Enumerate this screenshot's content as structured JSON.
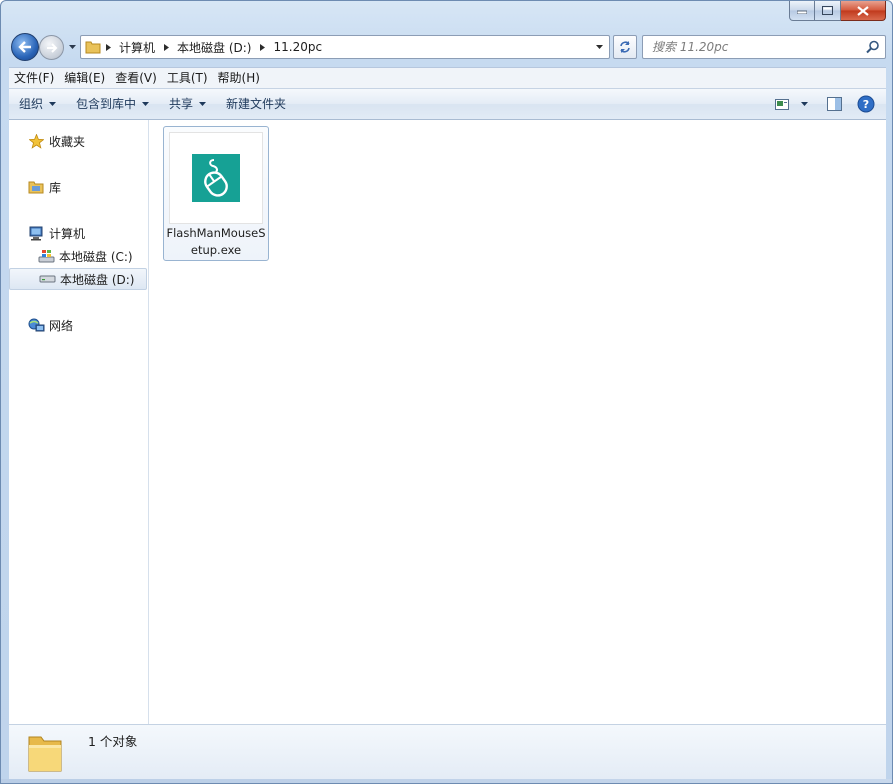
{
  "window": {
    "caption_buttons": {
      "minimize_icon": "minimize-icon",
      "maximize_icon": "maximize-icon",
      "close_icon": "close-icon"
    }
  },
  "nav": {
    "breadcrumbs": [
      "计算机",
      "本地磁盘 (D:)",
      "11.20pc"
    ],
    "search_placeholder": "搜索 11.20pc"
  },
  "menu": [
    "文件(F)",
    "编辑(E)",
    "查看(V)",
    "工具(T)",
    "帮助(H)"
  ],
  "commands": {
    "organize": "组织",
    "include_in_library": "包含到库中",
    "share": "共享",
    "new_folder": "新建文件夹"
  },
  "sidebar": {
    "favorites": "收藏夹",
    "libraries": "库",
    "computer": "计算机",
    "drive_c": "本地磁盘 (C:)",
    "drive_d": "本地磁盘 (D:)",
    "network": "网络",
    "selected": "本地磁盘 (D:)"
  },
  "files": [
    {
      "name": "FlashManMouseSetup.exe",
      "icon": "mouse-app-icon",
      "accent": "#16a195"
    }
  ],
  "details": {
    "count_text": "1 个对象"
  },
  "colors": {
    "accent": "#16a195",
    "selection_border": "#99b4d1"
  }
}
